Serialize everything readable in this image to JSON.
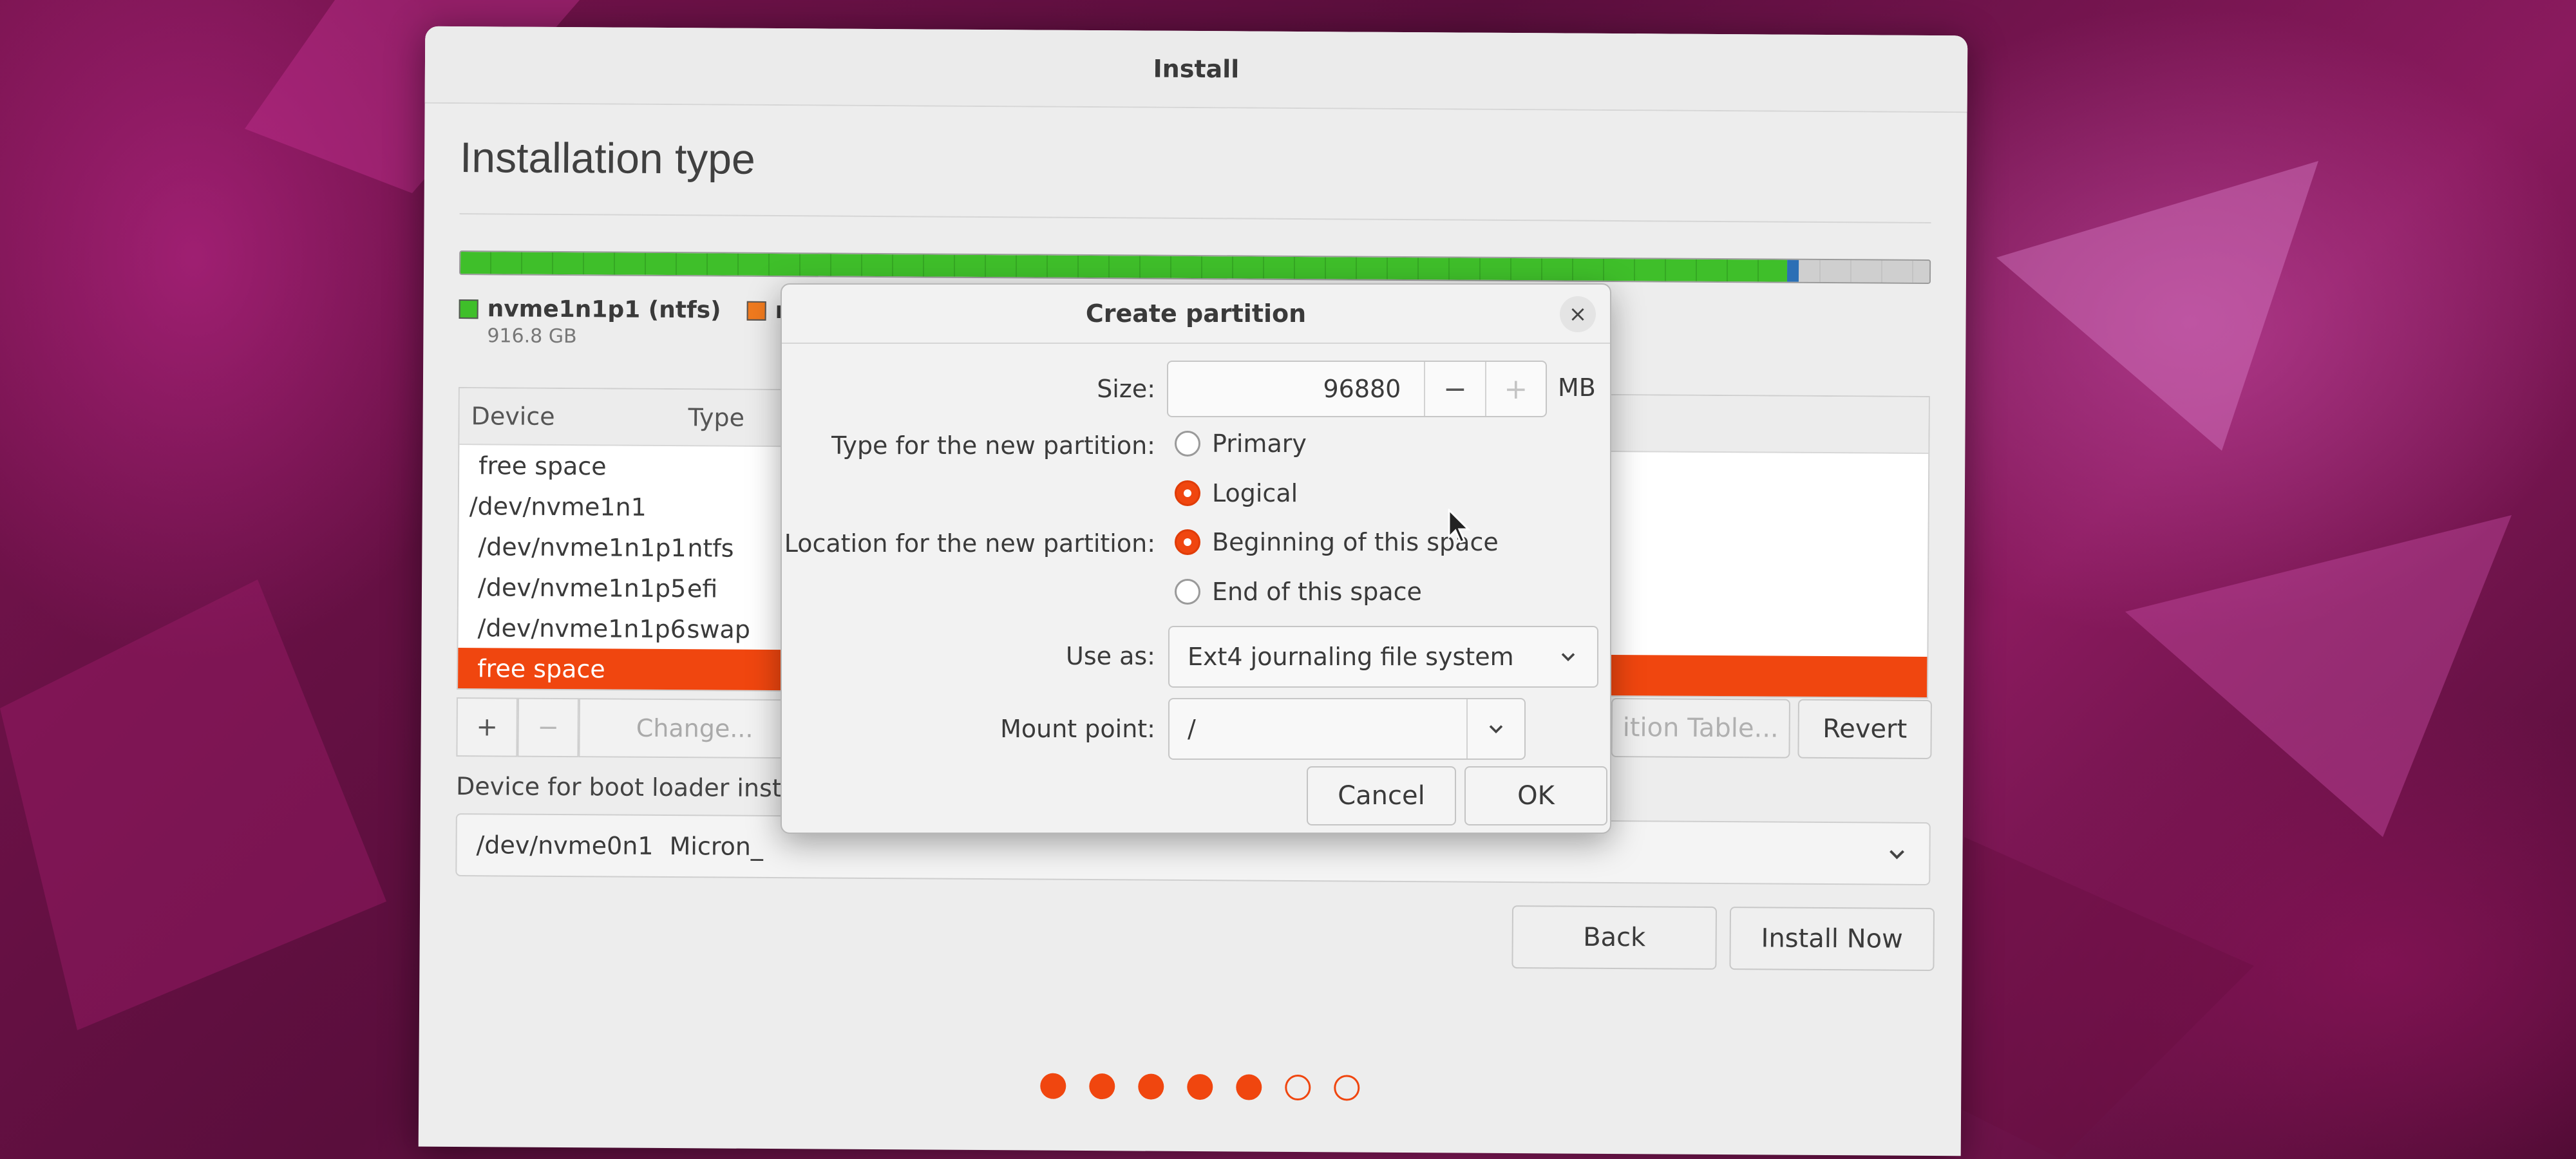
{
  "window": {
    "title": "Install"
  },
  "page": {
    "title": "Installation type"
  },
  "legend": [
    {
      "label": "nvme1n1p1 (ntfs)",
      "size": "916.8 GB",
      "color": "#3fbf2a"
    },
    {
      "label": "r",
      "size": "",
      "color": "#f07a1e"
    }
  ],
  "table": {
    "headers": {
      "device": "Device",
      "type": "Type"
    },
    "rows": [
      {
        "device": "free space",
        "type": ""
      },
      {
        "device": "/dev/nvme1n1",
        "type": ""
      },
      {
        "device": "/dev/nvme1n1p1",
        "type": "ntfs"
      },
      {
        "device": "/dev/nvme1n1p5",
        "type": "efi"
      },
      {
        "device": "/dev/nvme1n1p6",
        "type": "swap"
      },
      {
        "device": "free space",
        "type": "",
        "selected": true
      }
    ]
  },
  "toolbar": {
    "add": "+",
    "remove": "−",
    "change": "Change...",
    "partition_table": "ition Table...",
    "revert": "Revert"
  },
  "boot": {
    "label": "Device for boot loader inst",
    "device": "/dev/nvme0n1",
    "model": "Micron_"
  },
  "nav": {
    "back": "Back",
    "install_now": "Install Now"
  },
  "progress": {
    "total_steps": 7,
    "completed_steps": 5
  },
  "dialog": {
    "title": "Create partition",
    "close": "×",
    "size_label": "Size:",
    "size_value": "96880",
    "size_decrement": "−",
    "size_increment": "+",
    "size_unit": "MB",
    "type_label": "Type for the new partition:",
    "type_options": [
      "Primary",
      "Logical"
    ],
    "type_selected": "Logical",
    "location_label": "Location for the new partition:",
    "location_options": [
      "Beginning of this space",
      "End of this space"
    ],
    "location_selected": "Beginning of this space",
    "use_as_label": "Use as:",
    "use_as_value": "Ext4 journaling file system",
    "mount_label": "Mount point:",
    "mount_value": "/",
    "cancel": "Cancel",
    "ok": "OK"
  },
  "colors": {
    "accent": "#f0460f",
    "ntfs": "#3fbf2a",
    "efi": "#2b6fb5"
  }
}
